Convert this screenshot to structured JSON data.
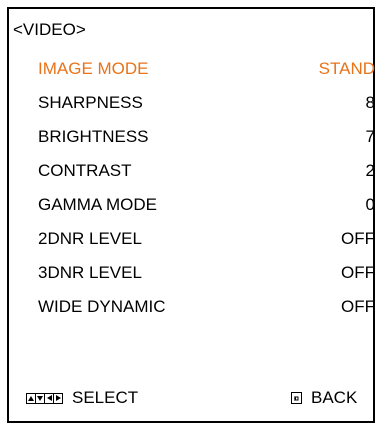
{
  "menu": {
    "title": "<VIDEO>",
    "items": [
      {
        "label": "IMAGE MODE",
        "value": "STAND"
      },
      {
        "label": "SHARPNESS",
        "value": "8"
      },
      {
        "label": "BRIGHTNESS",
        "value": "7"
      },
      {
        "label": "CONTRAST",
        "value": "2"
      },
      {
        "label": "GAMMA MODE",
        "value": "0"
      },
      {
        "label": "2DNR LEVEL",
        "value": "OFF"
      },
      {
        "label": "3DNR LEVEL",
        "value": "OFF"
      },
      {
        "label": "WIDE DYNAMIC",
        "value": "OFF"
      }
    ],
    "selected_index": 0,
    "selected_color": "#e8731a"
  },
  "footer": {
    "select_label": "SELECT",
    "select_icon": "arrow-keys-icon",
    "back_label": "BACK",
    "back_icon": "back-icon"
  }
}
